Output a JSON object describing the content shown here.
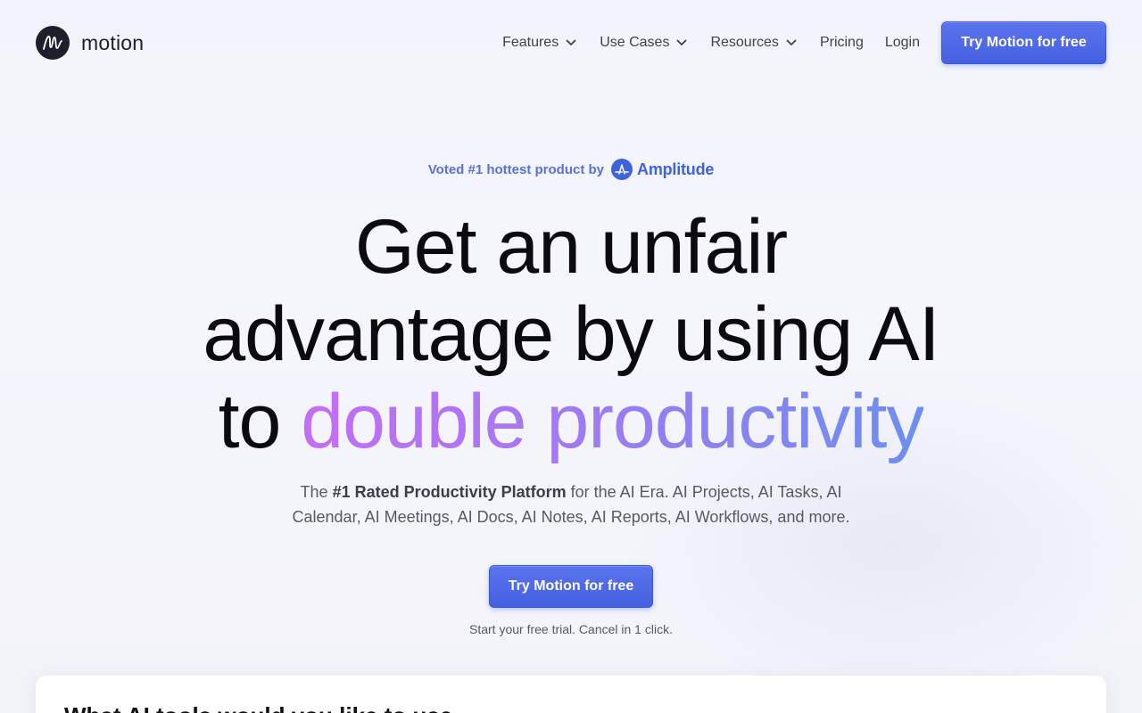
{
  "brand": {
    "name": "motion",
    "logo_icon": "motion-m-logo-icon"
  },
  "nav": {
    "items": [
      {
        "label": "Features",
        "has_dropdown": true
      },
      {
        "label": "Use Cases",
        "has_dropdown": true
      },
      {
        "label": "Resources",
        "has_dropdown": true
      },
      {
        "label": "Pricing",
        "has_dropdown": false
      },
      {
        "label": "Login",
        "has_dropdown": false
      }
    ],
    "cta_label": "Try Motion for free"
  },
  "hero": {
    "voted_text": "Voted #1 hottest product by",
    "voted_brand": "Amplitude",
    "headline_line1": "Get an unfair",
    "headline_line2": "advantage by using AI",
    "headline_line3_prefix": "to ",
    "headline_line3_highlight": "double productivity",
    "sub_prefix": "The ",
    "sub_bold": "#1 Rated Productivity Platform",
    "sub_line1_rest": " for the AI Era. AI Projects, AI Tasks, AI",
    "sub_line2": "Calendar, AI Meetings, AI Docs, AI Notes, AI Reports, AI Workflows, and more.",
    "cta_label": "Try Motion for free",
    "trial_note": "Start your free trial. Cancel in 1 click."
  },
  "card": {
    "title_partial": "What AI tools would you like to use"
  },
  "colors": {
    "primary": "#4a64e4",
    "accent_text": "#5a6fe0",
    "gradient_start": "#c56ef5",
    "gradient_end": "#6c8ff0",
    "amplitude_blue": "#3e63e0",
    "dark": "#1d1f2b"
  }
}
